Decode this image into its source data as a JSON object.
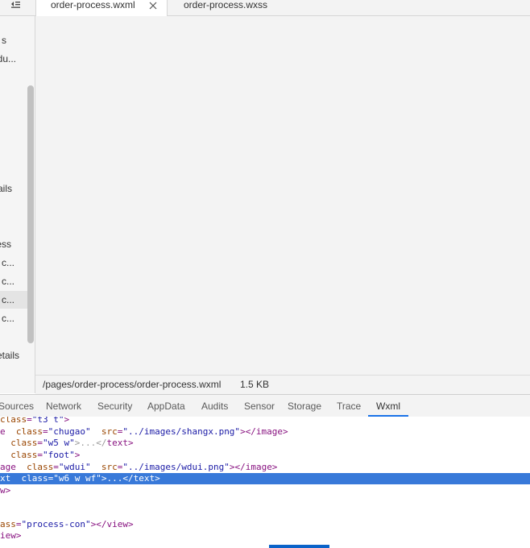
{
  "tabs": [
    {
      "label": "order-process.wxml",
      "active": true
    },
    {
      "label": "order-process.wxss",
      "active": false
    }
  ],
  "file_tree": {
    "items": [
      {
        "label": "s",
        "selected": false
      },
      {
        "label": "du...",
        "selected": false
      },
      {
        "label": "ails",
        "selected": false
      },
      {
        "label": "ess",
        "selected": false
      },
      {
        "label": "c...",
        "selected": false
      },
      {
        "label": "c...",
        "selected": false
      },
      {
        "label": "c...",
        "selected": true
      },
      {
        "label": "c...",
        "selected": false
      },
      {
        "label": "etails",
        "selected": false
      }
    ]
  },
  "status_bar": {
    "path": "/pages/order-process/order-process.wxml",
    "size": "1.5 KB"
  },
  "devtools": {
    "tabs": [
      "Sources",
      "Network",
      "Security",
      "AppData",
      "Audits",
      "Sensor",
      "Storage",
      "Trace",
      "Wxml"
    ],
    "active_tab": "Wxml"
  },
  "code": {
    "l1_attr": "class",
    "l1_val": "\"t3 t\"",
    "l2_tag": "e",
    "l2_attr1": "class",
    "l2_val1": "\"chugao\"",
    "l2_attr2": "src",
    "l2_val2": "\"../images/shangx.png\"",
    "l2_close": "</image>",
    "l3_attr": "class",
    "l3_val": "\"w5 w\"",
    "l3_mid": ">...</",
    "l3_close": "text>",
    "l4_attr": "class",
    "l4_val": "\"foot\"",
    "l5_tag": "age",
    "l5_attr1": "class",
    "l5_val1": "\"wdui\"",
    "l5_attr2": "src",
    "l5_val2": "\"../images/wdui.png\"",
    "l5_close": "</image>",
    "l6_tag": "xt",
    "l6_attr": "class",
    "l6_val": "\"w6 w wf\"",
    "l6_mid": ">...</",
    "l6_close": "text>",
    "l7": "w>",
    "l8_attr": "ass",
    "l8_val": "\"process-con\"",
    "l8_close": "</view>",
    "l9": "iew>"
  },
  "colors": {
    "selection": "#3879d9",
    "active_tab_underline": "#1a73e8"
  }
}
